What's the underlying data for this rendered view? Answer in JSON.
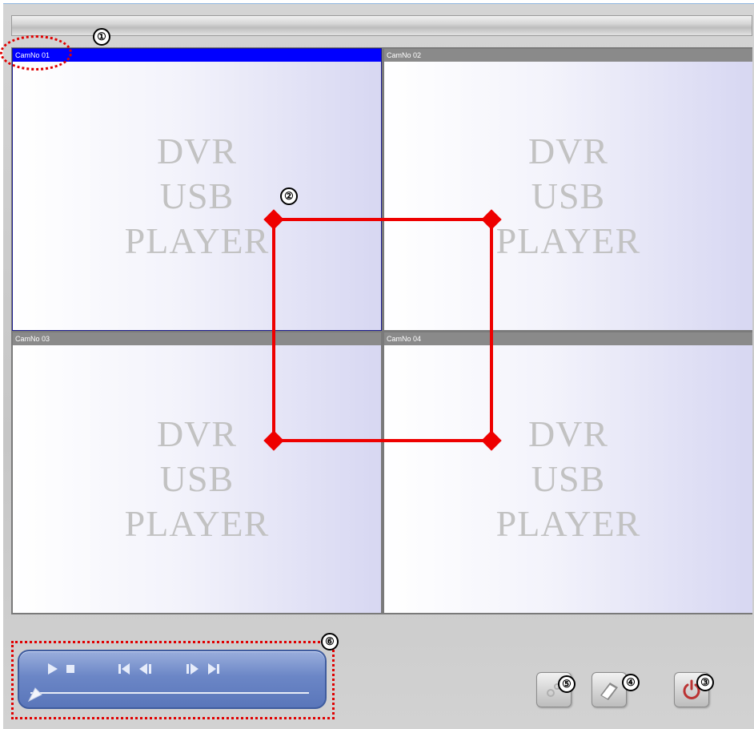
{
  "cameras": [
    {
      "label": "CamNo 01",
      "watermark": [
        "DVR",
        "USB",
        "PLAYER"
      ]
    },
    {
      "label": "CamNo 02",
      "watermark": [
        "DVR",
        "USB",
        "PLAYER"
      ]
    },
    {
      "label": "CamNo 03",
      "watermark": [
        "DVR",
        "USB",
        "PLAYER"
      ]
    },
    {
      "label": "CamNo 04",
      "watermark": [
        "DVR",
        "USB",
        "PLAYER"
      ]
    }
  ],
  "active_camera": "CamNo 01",
  "callouts": [
    "①",
    "②",
    "③",
    "④",
    "⑤",
    "⑥"
  ],
  "controls": {
    "icons": [
      "play-icon",
      "stop-icon",
      "skip-back-icon",
      "step-back-icon",
      "step-forward-icon",
      "skip-forward-icon",
      "seek-slider"
    ],
    "seek_position": 0.0
  },
  "tools": {
    "icons": [
      "settings-icon",
      "backup-icon",
      "power-icon"
    ]
  },
  "colors": {
    "active_header": "#0000ff",
    "inactive_header": "#8a8a8a",
    "annotation_red": "#e00000",
    "control_panel": "#6b86c6"
  }
}
